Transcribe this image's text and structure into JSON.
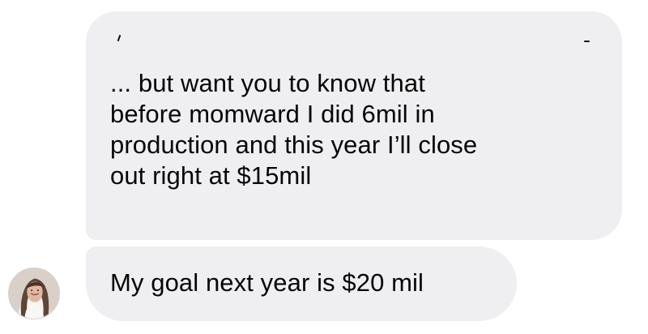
{
  "conversation": {
    "messages": [
      {
        "sender": "other",
        "text": "... but want you to know that\nbefore momward I did 6mil in\nproduction and this year I’ll close\nout right at $15mil"
      },
      {
        "sender": "other",
        "text": "My goal next year is $20 mil"
      }
    ],
    "avatar": {
      "icon": "avatar-photo"
    },
    "colors": {
      "bubble_background": "#efeff1",
      "text": "#060606",
      "page_background": "#ffffff"
    }
  }
}
